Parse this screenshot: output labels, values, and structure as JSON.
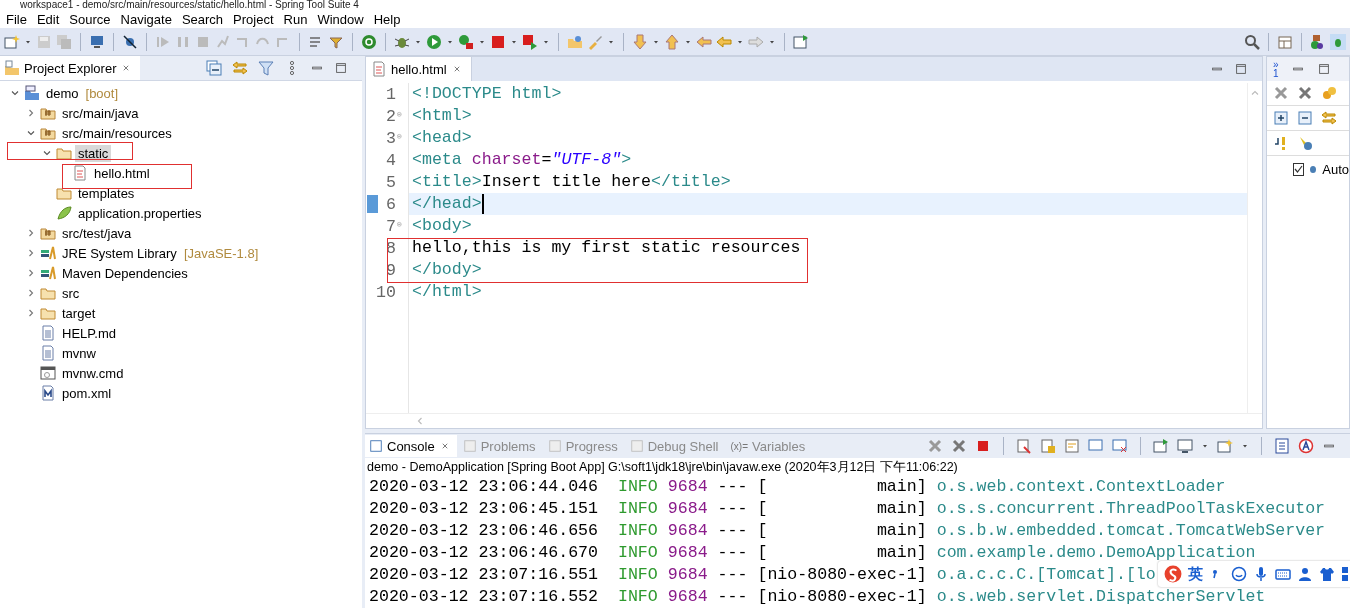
{
  "window": {
    "title": "workspace1 - demo/src/main/resources/static/hello.html - Spring Tool Suite 4"
  },
  "menu": [
    "File",
    "Edit",
    "Source",
    "Navigate",
    "Search",
    "Project",
    "Run",
    "Window",
    "Help"
  ],
  "project_explorer": {
    "title": "Project Explorer",
    "tree": [
      {
        "label": "demo",
        "decoration": "[boot]",
        "kind": "project",
        "expanded": true,
        "selected": false,
        "children": [
          {
            "label": "src/main/java",
            "kind": "package",
            "expanded": false,
            "selected": false
          },
          {
            "label": "src/main/resources",
            "kind": "package",
            "expanded": true,
            "selected": false,
            "children": [
              {
                "label": "static",
                "kind": "folder",
                "expanded": true,
                "selected": true,
                "children": [
                  {
                    "label": "hello.html",
                    "kind": "html",
                    "selected": false
                  }
                ]
              },
              {
                "label": "templates",
                "kind": "folder",
                "selected": false
              },
              {
                "label": "application.properties",
                "kind": "leaf",
                "selected": false
              }
            ]
          },
          {
            "label": "src/test/java",
            "kind": "package",
            "expanded": false,
            "selected": false
          },
          {
            "label": "JRE System Library",
            "decoration": "[JavaSE-1.8]",
            "kind": "library",
            "expanded": false,
            "selected": false
          },
          {
            "label": "Maven Dependencies",
            "kind": "library",
            "expanded": false,
            "selected": false
          },
          {
            "label": "src",
            "kind": "folder",
            "expanded": false,
            "selected": false
          },
          {
            "label": "target",
            "kind": "folder",
            "expanded": false,
            "selected": false
          },
          {
            "label": "HELP.md",
            "kind": "text",
            "selected": false
          },
          {
            "label": "mvnw",
            "kind": "text",
            "selected": false
          },
          {
            "label": "mvnw.cmd",
            "kind": "cmd",
            "selected": false
          },
          {
            "label": "pom.xml",
            "kind": "maven",
            "selected": false
          }
        ]
      }
    ]
  },
  "editor": {
    "tab": "hello.html",
    "lines": [
      {
        "number": "1",
        "foldable": false,
        "current": false,
        "tokens": [
          {
            "kind": "tag",
            "text": "<!DOCTYPE html>"
          }
        ]
      },
      {
        "number": "2",
        "foldable": true,
        "current": false,
        "tokens": [
          {
            "kind": "tag",
            "text": "<html>"
          }
        ]
      },
      {
        "number": "3",
        "foldable": true,
        "current": false,
        "tokens": [
          {
            "kind": "tag",
            "text": "<head>"
          }
        ]
      },
      {
        "number": "4",
        "foldable": false,
        "current": false,
        "tokens": [
          {
            "kind": "tag",
            "text": "<meta "
          },
          {
            "kind": "attr",
            "text": "charset"
          },
          {
            "kind": "text",
            "text": "="
          },
          {
            "kind": "value",
            "text": "\"UTF-8\""
          },
          {
            "kind": "tag",
            "text": ">"
          }
        ]
      },
      {
        "number": "5",
        "foldable": false,
        "current": false,
        "tokens": [
          {
            "kind": "tag",
            "text": "<title>"
          },
          {
            "kind": "text",
            "text": "Insert title here"
          },
          {
            "kind": "tag",
            "text": "</title>"
          }
        ]
      },
      {
        "number": "6",
        "foldable": false,
        "current": true,
        "tokens": [
          {
            "kind": "tag",
            "text": "</head>"
          }
        ]
      },
      {
        "number": "7",
        "foldable": true,
        "current": false,
        "tokens": [
          {
            "kind": "tag",
            "text": "<body>"
          }
        ]
      },
      {
        "number": "8",
        "foldable": false,
        "current": false,
        "tokens": [
          {
            "kind": "text",
            "text": "hello,this is my first static resources"
          }
        ]
      },
      {
        "number": "9",
        "foldable": false,
        "current": false,
        "tokens": [
          {
            "kind": "tag",
            "text": "</body>"
          }
        ]
      },
      {
        "number": "10",
        "foldable": false,
        "current": false,
        "tokens": [
          {
            "kind": "tag",
            "text": "</html>"
          }
        ]
      }
    ]
  },
  "side_panel": {
    "overflow_mark": "»",
    "overflow_count": "1",
    "items": [
      {
        "label": "Auto",
        "checked": true
      }
    ]
  },
  "console": {
    "tabs": [
      {
        "label": "Console",
        "selected": true
      },
      {
        "label": "Problems",
        "selected": false
      },
      {
        "label": "Progress",
        "selected": false
      },
      {
        "label": "Debug Shell",
        "selected": false
      },
      {
        "label": "Variables",
        "icon_text": "(x)=",
        "selected": false
      }
    ],
    "process": "demo - DemoApplication [Spring Boot App] G:\\soft1\\jdk18\\jre\\bin\\javaw.exe (2020年3月12日 下午11:06:22)",
    "lines": [
      {
        "time": "2020-03-12 23:06:44.046",
        "level": "INFO",
        "pid": "9684",
        "sep": "---",
        "thread": "[           main]",
        "logger": "o.s.web.context.ContextLoader"
      },
      {
        "time": "2020-03-12 23:06:45.151",
        "level": "INFO",
        "pid": "9684",
        "sep": "---",
        "thread": "[           main]",
        "logger": "o.s.s.concurrent.ThreadPoolTaskExecutor"
      },
      {
        "time": "2020-03-12 23:06:46.656",
        "level": "INFO",
        "pid": "9684",
        "sep": "---",
        "thread": "[           main]",
        "logger": "o.s.b.w.embedded.tomcat.TomcatWebServer"
      },
      {
        "time": "2020-03-12 23:06:46.670",
        "level": "INFO",
        "pid": "9684",
        "sep": "---",
        "thread": "[           main]",
        "logger": "com.example.demo.DemoApplication"
      },
      {
        "time": "2020-03-12 23:07:16.551",
        "level": "INFO",
        "pid": "9684",
        "sep": "---",
        "thread": "[nio-8080-exec-1]",
        "logger": "o.a.c.c.C.[Tomcat].[lo"
      },
      {
        "time": "2020-03-12 23:07:16.552",
        "level": "INFO",
        "pid": "9684",
        "sep": "---",
        "thread": "[nio-8080-exec-1]",
        "logger": "o.s.web.servlet.DispatcherServlet"
      }
    ]
  },
  "ime_bar": {
    "mode": "英"
  }
}
